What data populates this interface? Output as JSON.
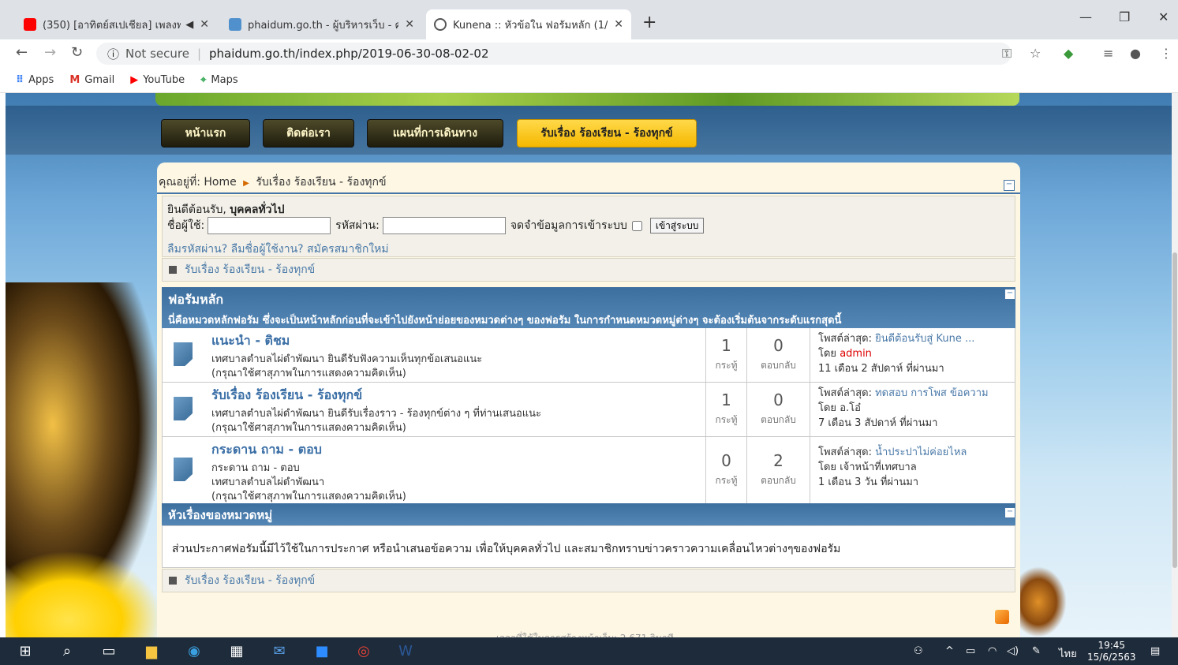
{
  "browser": {
    "tabs": [
      {
        "title": "(350) [อาทิตย์สเปเชียล] เพลงพา",
        "icon": "youtube-icon",
        "color": "#ff0000"
      },
      {
        "title": "phaidum.go.th - ผู้บริหารเว็บ - คอน",
        "icon": "joomla-icon",
        "color": "#5091cd"
      },
      {
        "title": "Kunena :: หัวข้อใน ฟอรัมหลัก (1/1)",
        "icon": "globe-icon",
        "color": "#555555"
      }
    ],
    "not_secure": "Not secure",
    "url": "phaidum.go.th/index.php/2019-06-30-08-02-02",
    "bookmarks": [
      "Apps",
      "Gmail",
      "YouTube",
      "Maps"
    ]
  },
  "site": {
    "nav": [
      "หน้าแรก",
      "ติดต่อเรา",
      "แผนที่การเดินทาง",
      "รับเรื่อง ร้องเรียน - ร้องทุกข์"
    ],
    "breadcrumb": {
      "prefix": "คุณอยู่ที่:",
      "home": "Home",
      "current": "รับเรื่อง ร้องเรียน - ร้องทุกข์"
    },
    "login": {
      "welcome": "ยินดีต้อนรับ,",
      "guest": "บุคคลทั่วไป",
      "username_label": "ชื่อผู้ใช้:",
      "password_label": "รหัสผ่าน:",
      "remember_label": "จดจำข้อมูลการเข้าระบบ",
      "login_button": "เข้าสู่ระบบ",
      "forgot_password": "ลืมรหัสผ่าน?",
      "forgot_username": "ลืมชื่อผู้ใช้งาน?",
      "register": "สมัครสมาชิกใหม่"
    },
    "path_label": "รับเรื่อง ร้องเรียน - ร้องทุกข์",
    "forum_section": {
      "title": "ฟอรัมหลัก",
      "subtitle": "นี่คือหมวดหลักฟอรัม ซึ่งจะเป็นหน้าหลักก่อนที่จะเข้าไปยังหน้าย่อยของหมวดต่างๆ ของฟอรัม ในการกำหนดหมวดหมู่ต่างๆ จะต้องเริ่มต้นจากระดับแรกสุดนี้",
      "topics_label": "กระทู้",
      "replies_label": "ตอบกลับ",
      "last_post_label": "โพสต์ล่าสุด:",
      "by_label": "โดย",
      "forums": [
        {
          "name": "แนะนำ - ติชม",
          "desc": [
            "เทศบาลตำบลไผ่ดำพัฒนา ยินดีรับฟังความเห็นทุกข้อเสนอแนะ",
            "(กรุณาใช้ศาสุภาพในการแสดงความคิดเห็น)"
          ],
          "topics": "1",
          "replies": "0",
          "last_post": "ยินดีต้อนรับสู่ Kune ...",
          "author": "admin",
          "when": "11 เดือน 2 สัปดาห์ ที่ผ่านมา"
        },
        {
          "name": "รับเรื่อง ร้องเรียน - ร้องทุกข์",
          "desc": [
            "เทศบาลตำบลไผ่ดำพัฒนา ยินดีรับเรื่องราว - ร้องทุกข์ต่าง ๆ ที่ท่านเสนอแนะ",
            "(กรุณาใช้ศาสุภาพในการแสดงความคิดเห็น)"
          ],
          "topics": "1",
          "replies": "0",
          "last_post": "ทดสอบ การโพส ข้อความ",
          "author": "อ.โอ๋",
          "when": "7 เดือน 3 สัปดาห์ ที่ผ่านมา"
        },
        {
          "name": "กระดาน ถาม - ตอบ",
          "desc": [
            "กระดาน ถาม - ตอบ",
            "เทศบาลตำบลไผ่ดำพัฒนา",
            "(กรุณาใช้ศาสุภาพในการแสดงความคิดเห็น)"
          ],
          "topics": "0",
          "replies": "2",
          "last_post": "น้ำประปาไม่ค่อยไหล",
          "author": "เจ้าหน้าที่เทศบาล",
          "when": "1 เดือน 3 วัน ที่ผ่านมา"
        }
      ]
    },
    "category_section": {
      "title": "หัวเรื่องของหมวดหมู่",
      "body": "ส่วนประกาศฟอรัมนี้มีไว้ใช้ในการประกาศ หรือนำเสนอข้อความ เพื่อให้บุคคลทั่วไป และสมาชิกทราบข่าวคราวความเคลื่อนไหวต่างๆของฟอรัม"
    },
    "footer_gentime": "เวลาที่ใช้ในการสร้างหน้าเว็บ: 2.671 วินาที"
  },
  "taskbar": {
    "lang": "ไทย",
    "time": "19:45",
    "date": "15/6/2563"
  }
}
